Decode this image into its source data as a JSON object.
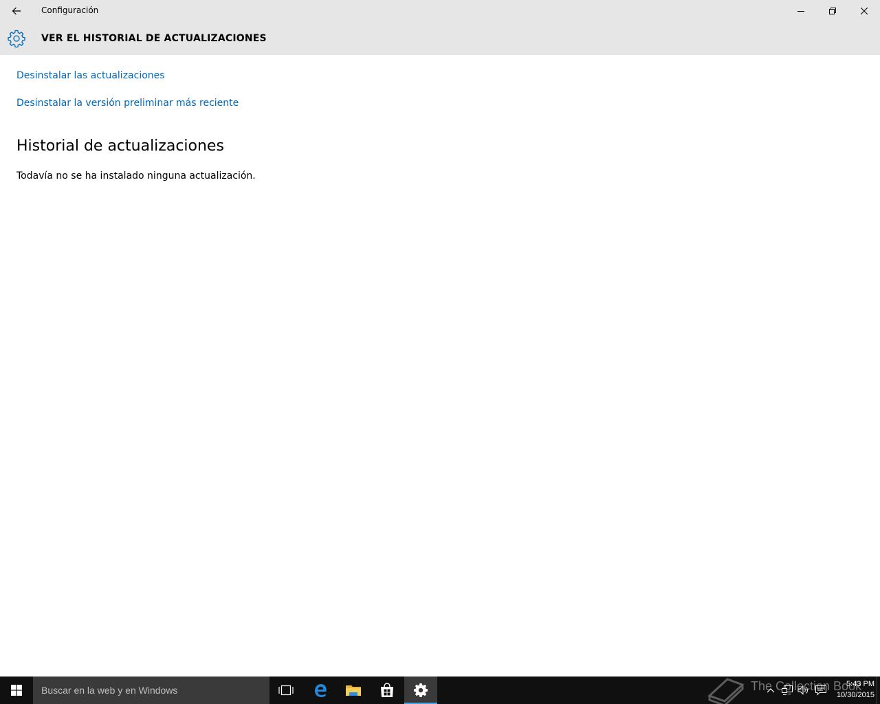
{
  "window": {
    "app_title": "Configuración",
    "back_icon": "back-arrow-icon",
    "controls": {
      "minimize_icon": "minimize-icon",
      "restore_icon": "restore-icon",
      "close_icon": "close-icon"
    }
  },
  "header": {
    "icon": "gear-icon",
    "title": "VER EL HISTORIAL DE ACTUALIZACIONES"
  },
  "content": {
    "links": [
      {
        "label": "Desinstalar las actualizaciones"
      },
      {
        "label": "Desinstalar la versión preliminar más reciente"
      }
    ],
    "history_heading": "Historial de actualizaciones",
    "history_status": "Todavía no se ha instalado ninguna actualización."
  },
  "taskbar": {
    "search_placeholder": "Buscar en la web y en Windows",
    "pinned": [
      {
        "icon": "task-view-icon"
      },
      {
        "icon": "edge-icon"
      },
      {
        "icon": "file-explorer-icon"
      },
      {
        "icon": "store-icon"
      },
      {
        "icon": "settings-icon",
        "active": true
      }
    ],
    "watermark": "The Collection Book",
    "tray_icons": [
      "chevron-up-icon",
      "network-icon",
      "volume-icon",
      "action-center-icon"
    ],
    "clock": {
      "time": "5:43 PM",
      "date": "10/30/2015"
    }
  },
  "colors": {
    "accent": "#0067b8",
    "chrome": "#e6e6e6",
    "taskbar": "#101010",
    "search_box": "#3a3a3a",
    "active_indicator": "#4aa3df"
  }
}
